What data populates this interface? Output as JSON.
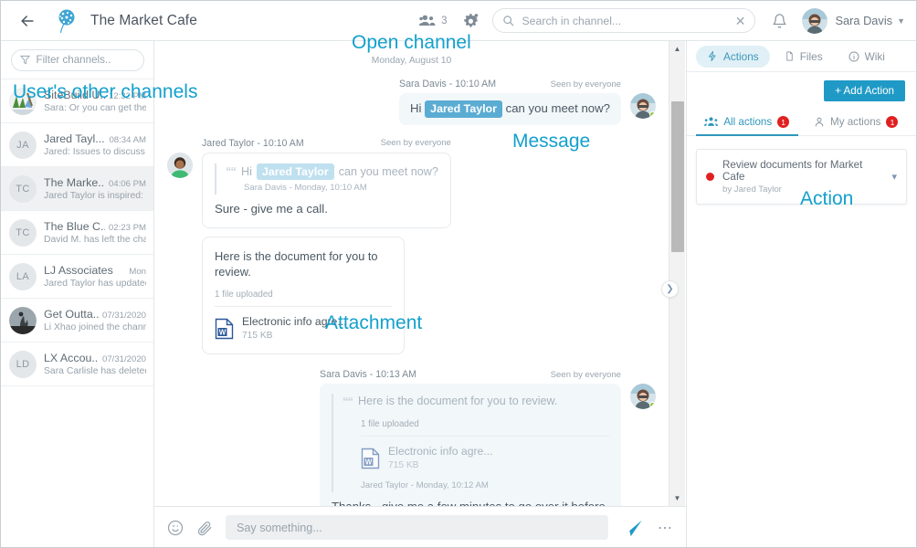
{
  "header": {
    "back_icon": "arrow-left-icon",
    "logo_icon": "dandelion-logo",
    "title": "The Market Cafe",
    "members_icon": "people-icon",
    "members_count": "3",
    "settings_icon": "gear-icon",
    "search": {
      "icon": "search-icon",
      "placeholder": "Search in channel...",
      "value": "",
      "clear_icon": "close-icon"
    },
    "bell_icon": "bell-icon",
    "user_name": "Sara Davis",
    "user_caret": "chevron-down-icon"
  },
  "sidebar": {
    "filter": {
      "icon": "funnel-icon",
      "placeholder": "Filter channels.."
    },
    "channels": [
      {
        "initials": "",
        "name": "SiteBuild U...",
        "time": "12:32 PM",
        "preview": "Sara: Or you can get the ...",
        "active": false,
        "photo": true
      },
      {
        "initials": "JA",
        "name": "Jared Tayl...",
        "time": "08:34 AM",
        "preview": "Jared: Issues to discuss ...",
        "active": false,
        "photo": false
      },
      {
        "initials": "TC",
        "name": "The Marke...",
        "time": "04:06 PM",
        "preview": "Jared Taylor is inspired: \"...",
        "active": true,
        "photo": false
      },
      {
        "initials": "TC",
        "name": "The Blue C...",
        "time": "02:23 PM",
        "preview": "David M. has left the cha...",
        "active": false,
        "photo": false
      },
      {
        "initials": "LA",
        "name": "LJ Associates",
        "time": "Mon",
        "preview": "Jared Taylor has updated...",
        "active": false,
        "photo": false
      },
      {
        "initials": "",
        "name": "Get Outta...",
        "time": "07/31/2020",
        "preview": "Li Xhao joined the channel",
        "active": false,
        "photo": true
      },
      {
        "initials": "LD",
        "name": "LX Accou...",
        "time": "07/31/2020",
        "preview": "Sara Carlisle has deleted ...",
        "active": false,
        "photo": false
      }
    ]
  },
  "chat": {
    "day_separator": "Monday, August 10",
    "messages": {
      "m1": {
        "author": "Sara Davis - 10:10 AM",
        "seen": "Seen by everyone",
        "text_before": "Hi",
        "mention": "Jared Taylor",
        "text_after": "can you meet now?"
      },
      "m2": {
        "author": "Jared Taylor - 10:10 AM",
        "seen": "Seen by everyone",
        "quote_before": "Hi",
        "quote_mention": "Jared Taylor",
        "quote_after": "can you meet now?",
        "quote_meta": "Sara Davis - Monday, 10:10 AM",
        "body": "Sure - give me a call."
      },
      "m3": {
        "text": "Here is the document for you to review.",
        "file_count": "1 file uploaded",
        "file_name": "Electronic info agre...",
        "file_size": "715 KB",
        "file_icon": "word-doc-icon"
      },
      "m4": {
        "author": "Sara Davis - 10:13 AM",
        "seen": "Seen by everyone",
        "quote_text": "Here is the document for you to review.",
        "quote_file_count": "1 file uploaded",
        "quote_file_name": "Electronic info agre...",
        "quote_file_size": "715 KB",
        "quote_meta": "Jared Taylor - Monday, 10:12 AM",
        "body": "Thanks - give me a few minutes to go over it before we meet."
      }
    },
    "scrollbar": {
      "up_icon": "triangle-up-icon",
      "down_icon": "triangle-down-icon",
      "collapse_icon": "chevron-right-icon"
    }
  },
  "composer": {
    "emoji_icon": "emoji-icon",
    "attach_icon": "paperclip-icon",
    "placeholder": "Say something...",
    "value": "",
    "send_icon": "send-icon",
    "more_icon": "ellipsis-icon"
  },
  "right_panel": {
    "tabs": [
      {
        "label": "Actions",
        "icon": "lightning-icon",
        "selected": true
      },
      {
        "label": "Files",
        "icon": "file-icon",
        "selected": false
      },
      {
        "label": "Wiki",
        "icon": "info-icon",
        "selected": false
      }
    ],
    "add_action_label": "+ Add Action",
    "action_tabs": [
      {
        "label": "All actions",
        "icon": "group-icon",
        "count": "1",
        "selected": true
      },
      {
        "label": "My actions",
        "icon": "person-icon",
        "count": "1",
        "selected": false
      }
    ],
    "actions": [
      {
        "title": "Review documents for Market Cafe",
        "by": "by Jared Taylor",
        "status_color": "#e02020",
        "chevron": "chevron-down-icon"
      }
    ]
  },
  "annotations": {
    "open_channel": "Open channel",
    "user_channels": "User's other channels",
    "message": "Message",
    "attachment": "Attachment",
    "action": "Action",
    "color": "#13a0cd"
  }
}
